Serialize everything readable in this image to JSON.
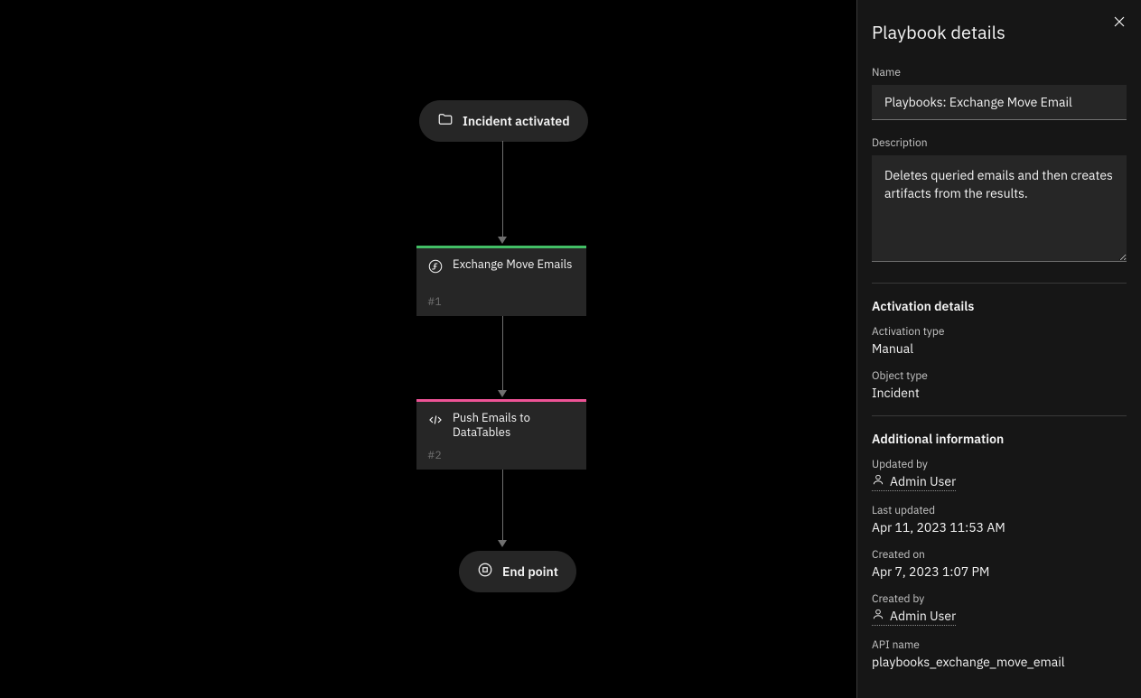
{
  "panel": {
    "title": "Playbook details",
    "name_label": "Name",
    "name_value": "Playbooks: Exchange Move Email",
    "description_label": "Description",
    "description_value": "Deletes queried emails and then creates artifacts from the results."
  },
  "activation": {
    "heading": "Activation details",
    "type_label": "Activation type",
    "type_value": "Manual",
    "object_label": "Object type",
    "object_value": "Incident"
  },
  "additional": {
    "heading": "Additional information",
    "updated_by_label": "Updated by",
    "updated_by_value": "Admin User",
    "last_updated_label": "Last updated",
    "last_updated_value": "Apr 11, 2023 11:53 AM",
    "created_on_label": "Created on",
    "created_on_value": "Apr 7, 2023 1:07 PM",
    "created_by_label": "Created by",
    "created_by_value": "Admin User",
    "api_name_label": "API name",
    "api_name_value": "playbooks_exchange_move_email"
  },
  "canvas": {
    "start_label": "Incident activated",
    "end_label": "End point",
    "nodes": [
      {
        "title": "Exchange Move Emails",
        "id": "#1"
      },
      {
        "title": "Push Emails to DataTables",
        "id": "#2"
      }
    ]
  },
  "colors": {
    "node_green": "#42be65",
    "node_pink": "#ee5396"
  }
}
